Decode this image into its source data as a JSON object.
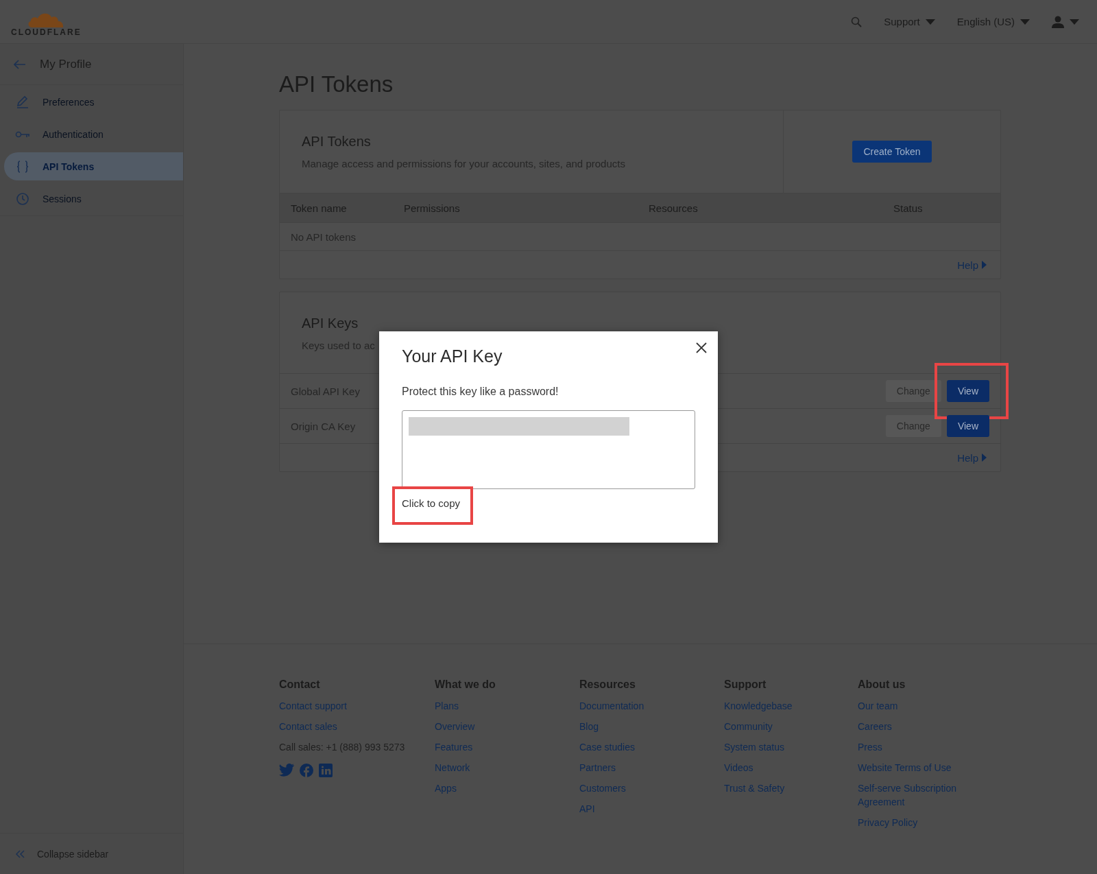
{
  "header": {
    "logo": "CLOUDFLARE",
    "menus": [
      {
        "label": "Support"
      },
      {
        "label": "English (US)"
      }
    ]
  },
  "sidebar": {
    "back_label": "My Profile",
    "items": [
      {
        "label": "Preferences",
        "selected": false
      },
      {
        "label": "Authentication",
        "selected": false
      },
      {
        "label": "API Tokens",
        "selected": true
      },
      {
        "label": "Sessions",
        "selected": false
      }
    ],
    "collapse_label": "Collapse sidebar"
  },
  "page_title": "API Tokens",
  "tokens_card": {
    "title": "API Tokens",
    "description": "Manage access and permissions for your accounts, sites, and products",
    "create_button": "Create Token",
    "columns": [
      "Token name",
      "Permissions",
      "Resources",
      "Status"
    ],
    "empty_text": "No API tokens",
    "help_link": "Help"
  },
  "keys_card": {
    "title": "API Keys",
    "description": "Keys used to ac",
    "rows": [
      {
        "name": "Global API Key",
        "change_button": "Change",
        "view_button": "View",
        "highlighted": true
      },
      {
        "name": "Origin CA Key",
        "change_button": "Change",
        "view_button": "View",
        "highlighted": false
      }
    ],
    "help_link": "Help"
  },
  "modal": {
    "title": "Your API Key",
    "message": "Protect this key like a password!",
    "key_redacted": true,
    "copy_link": "Click to copy",
    "copy_highlighted": true
  },
  "footer": {
    "columns": [
      {
        "heading": "Contact",
        "items": [
          {
            "text": "Contact support",
            "kind": "link"
          },
          {
            "text": "Contact sales",
            "kind": "link"
          },
          {
            "text": "Call sales: +1 (888) 993 5273",
            "kind": "text"
          }
        ],
        "social_icons": true
      },
      {
        "heading": "What we do",
        "items": [
          {
            "text": "Plans",
            "kind": "link"
          },
          {
            "text": "Overview",
            "kind": "link"
          },
          {
            "text": "Features",
            "kind": "link"
          },
          {
            "text": "Network",
            "kind": "link"
          },
          {
            "text": "Apps",
            "kind": "link"
          }
        ]
      },
      {
        "heading": "Resources",
        "items": [
          {
            "text": "Documentation",
            "kind": "link"
          },
          {
            "text": "Blog",
            "kind": "link"
          },
          {
            "text": "Case studies",
            "kind": "link"
          },
          {
            "text": "Partners",
            "kind": "link"
          },
          {
            "text": "Customers",
            "kind": "link"
          },
          {
            "text": "API",
            "kind": "link"
          }
        ]
      },
      {
        "heading": "Support",
        "items": [
          {
            "text": "Knowledgebase",
            "kind": "link"
          },
          {
            "text": "Community",
            "kind": "link"
          },
          {
            "text": "System status",
            "kind": "link"
          },
          {
            "text": "Videos",
            "kind": "link"
          },
          {
            "text": "Trust & Safety",
            "kind": "link"
          }
        ]
      },
      {
        "heading": "About us",
        "items": [
          {
            "text": "Our team",
            "kind": "link"
          },
          {
            "text": "Careers",
            "kind": "link"
          },
          {
            "text": "Press",
            "kind": "link"
          },
          {
            "text": "Website Terms of Use",
            "kind": "link"
          },
          {
            "text": "Self-serve Subscription Agreement",
            "kind": "link"
          },
          {
            "text": "Privacy Policy",
            "kind": "link"
          }
        ]
      }
    ]
  }
}
